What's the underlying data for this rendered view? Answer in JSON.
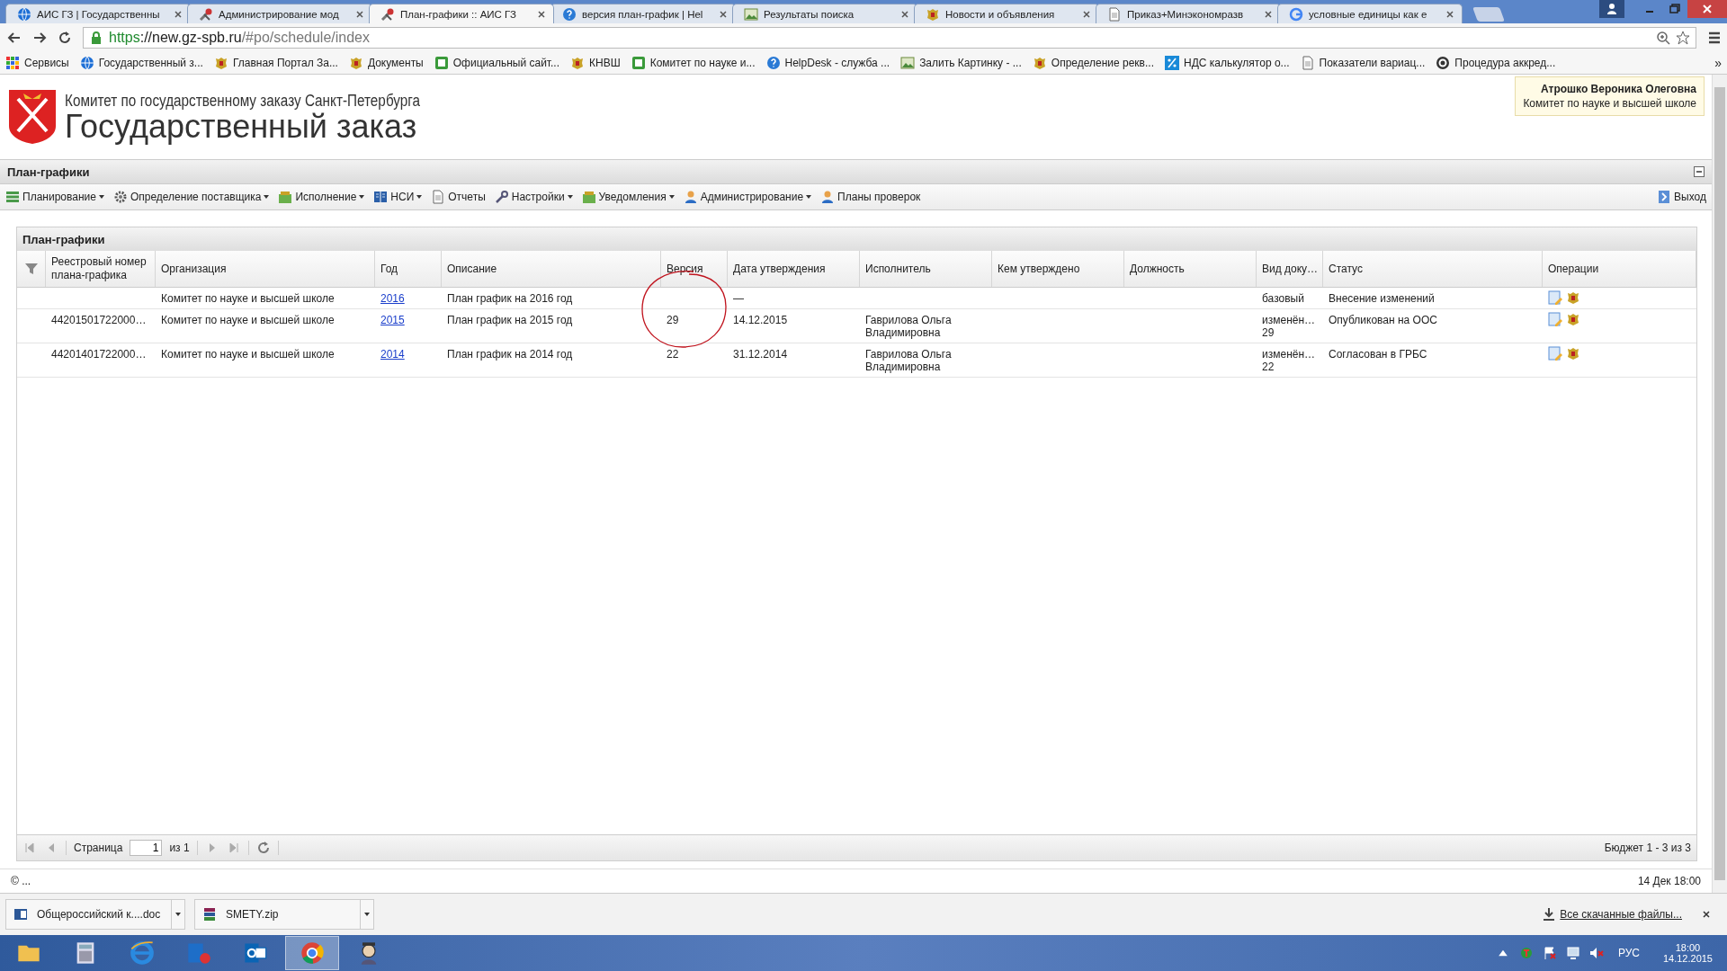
{
  "browser": {
    "tabs": [
      {
        "title": "АИС ГЗ | Государственны",
        "selected": false
      },
      {
        "title": "Администрирование мод",
        "selected": false
      },
      {
        "title": "План-графики :: АИС ГЗ",
        "selected": true
      },
      {
        "title": "версия план-график | Hel",
        "selected": false
      },
      {
        "title": "Результаты поиска",
        "selected": false
      },
      {
        "title": "Новости и объявления",
        "selected": false
      },
      {
        "title": "Приказ+Минэкономразв",
        "selected": false
      },
      {
        "title": "условные единицы как е",
        "selected": false
      }
    ],
    "address": {
      "scheme": "https",
      "host": "://new.gz-spb.ru",
      "path": "/#po/schedule/index"
    },
    "bookmarks": [
      "Сервисы",
      "Государственный з...",
      "Главная Портал За...",
      "Документы",
      "Официальный сайт...",
      "КНВШ",
      "Комитет по науке и...",
      "HelpDesk - служба ...",
      "Залить Картинку - ...",
      "Определение рекв...",
      "НДС калькулятор о...",
      "Показатели вариац...",
      "Процедура аккред..."
    ],
    "more_bookmarks": "»"
  },
  "header": {
    "org_name": "Комитет по государственному заказу Санкт-Петербурга",
    "system_name": "Государственный заказ",
    "user": {
      "name": "Атрошко Вероника Олеговна",
      "department": "Комитет по науке и высшей школе"
    }
  },
  "module": {
    "title": "План-графики",
    "menu": [
      {
        "label": "Планирование",
        "dropdown": true
      },
      {
        "label": "Определение поставщика",
        "dropdown": true
      },
      {
        "label": "Исполнение",
        "dropdown": true
      },
      {
        "label": "НСИ",
        "dropdown": true
      },
      {
        "label": "Отчеты",
        "dropdown": false
      },
      {
        "label": "Настройки",
        "dropdown": true
      },
      {
        "label": "Уведомления",
        "dropdown": true
      },
      {
        "label": "Администрирование",
        "dropdown": true
      },
      {
        "label": "Планы проверок",
        "dropdown": false
      }
    ],
    "logout": "Выход"
  },
  "grid": {
    "title": "План-графики",
    "columns": [
      "Реестровый номер плана-графика",
      "Организация",
      "Год",
      "Описание",
      "Версия",
      "Дата утверждения",
      "Исполнитель",
      "Кем утверждено",
      "Должность",
      "Вид доку…",
      "Статус",
      "Операции"
    ],
    "rows": [
      {
        "organization": "Комитет по науке и высшей школе",
        "year": "2016",
        "description": "План график на 2016 год",
        "approval_date": "—",
        "doc_type": "базовый",
        "status": "Внесение изменений"
      },
      {
        "reg_number": "44201501722000…",
        "organization": "Комитет по науке и высшей школе",
        "year": "2015",
        "description": "План график на 2015 год",
        "version": "29",
        "approval_date": "14.12.2015",
        "executor": "Гаврилова Ольга Владимировна",
        "doc_type": "изменён…\n29",
        "status": "Опубликован на ООС"
      },
      {
        "reg_number": "44201401722000…",
        "organization": "Комитет по науке и высшей школе",
        "year": "2014",
        "description": "План график на 2014 год",
        "version": "22",
        "approval_date": "31.12.2014",
        "executor": "Гаврилова Ольга Владимировна",
        "doc_type": "изменён…\n22",
        "status": "Согласован в ГРБС"
      }
    ],
    "pager": {
      "page_label": "Страница",
      "page": "1",
      "of": "из 1",
      "summary": "Бюджет 1 - 3 из 3"
    }
  },
  "annotation": {
    "kind": "circle"
  },
  "status_bar": {
    "left": "© ...",
    "right": "14 Дек 18:00"
  },
  "downloads": {
    "items": [
      "Общероссийский к....doc",
      "SMETY.zip"
    ],
    "show_all": "Все скачанные файлы..."
  },
  "taskbar": {
    "language": "РУС",
    "time": "18:00",
    "date": "14.12.2015"
  }
}
